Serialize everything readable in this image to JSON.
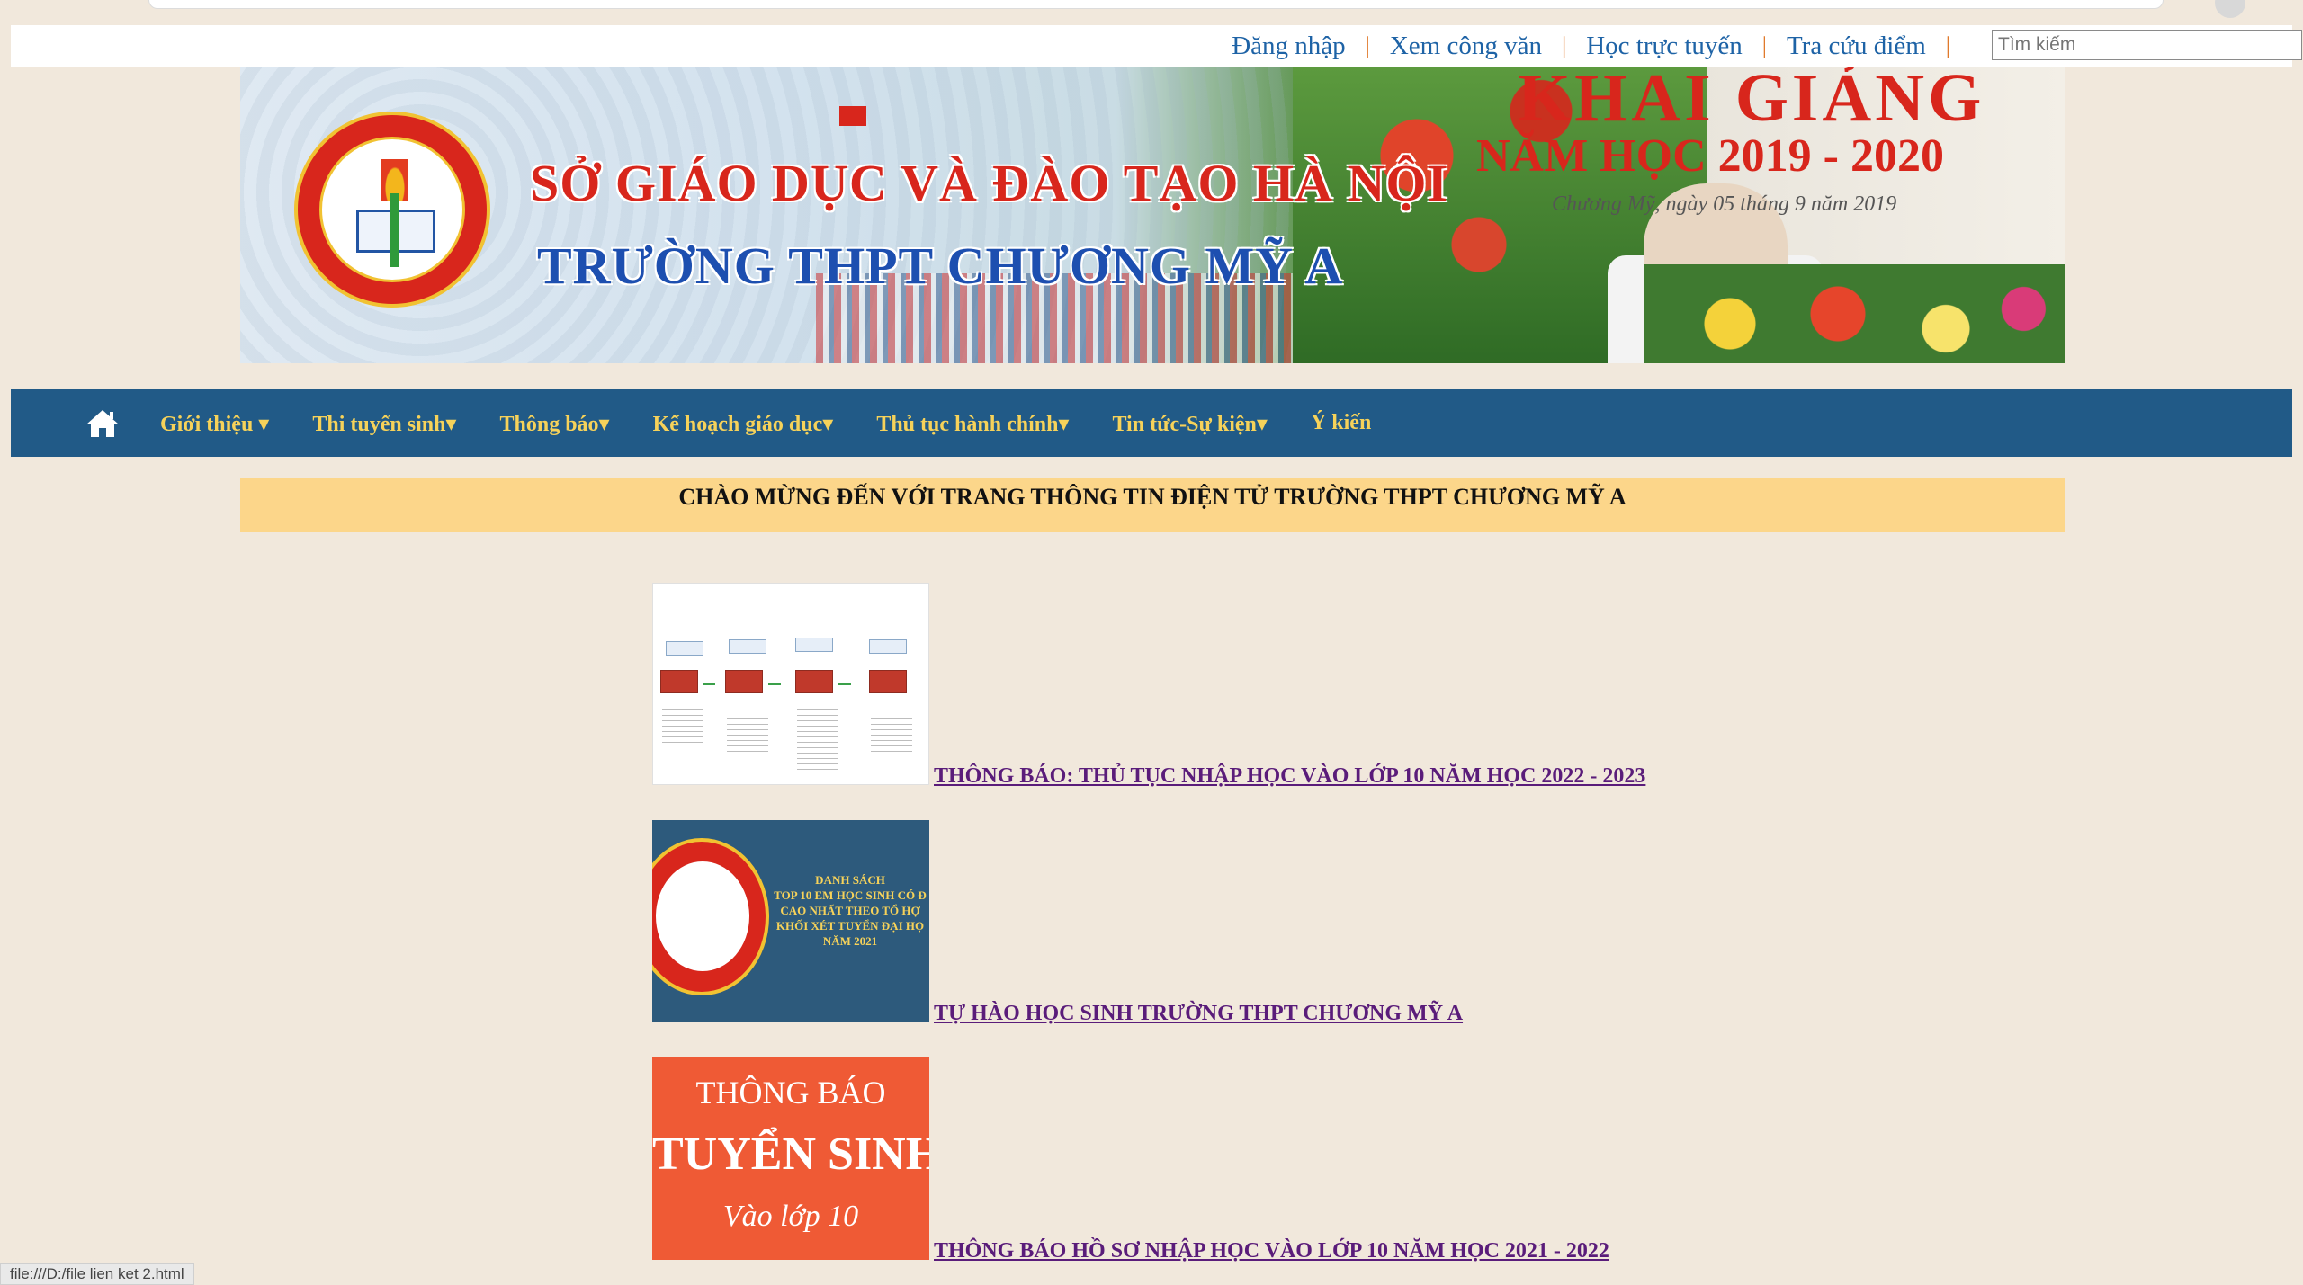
{
  "top_links": [
    "Đăng nhập",
    "Xem công văn",
    "Học trực tuyến",
    "Tra cứu điểm"
  ],
  "search": {
    "placeholder": "Tìm kiếm"
  },
  "banner": {
    "line1": "SỞ GIÁO DỤC VÀ ĐÀO TẠO HÀ NỘI",
    "line2": "TRƯỜNG THPT CHƯƠNG MỸ A",
    "event_title": "KHAI GIẢNG",
    "event_year": "NĂM HỌC 2019 - 2020",
    "event_date": "Chương Mỹ, ngày 05 tháng 9 năm 2019"
  },
  "nav": {
    "items": [
      "Giới thiệu ▾",
      "Thi tuyển sinh▾",
      "Thông báo▾",
      "Kế hoạch giáo dục▾",
      "Thủ tục hành chính▾",
      "Tin tức-Sự kiện▾",
      "Ý kiến"
    ]
  },
  "welcome": "CHÀO MỪNG ĐẾN VỚI TRANG THÔNG TIN ĐIỆN TỬ TRƯỜNG THPT CHƯƠNG MỸ A",
  "news": [
    {
      "title": "THÔNG BÁO: THỦ TỤC NHẬP HỌC VÀO LỚP 10 NĂM HỌC 2022 - 2023"
    },
    {
      "title": "TỰ HÀO HỌC SINH TRƯỜNG THPT CHƯƠNG MỸ A"
    },
    {
      "title": "THÔNG BÁO HỒ SƠ NHẬP HỌC VÀO LỚP 10 NĂM HỌC 2021 - 2022"
    }
  ],
  "thumb2_text": "DANH SÁCH\nTOP 10 EM HỌC SINH CÓ Đ\nCAO NHẤT THEO TỔ HỢ\nKHỐI XÉT TUYỂN ĐẠI HỌ\nNĂM 2021",
  "thumb3": {
    "line1": "THÔNG BÁO",
    "line2": "TUYỂN SINH",
    "line3": "Vào lớp 10"
  },
  "status_url": "file:///D:/file lien ket 2.html",
  "colors": {
    "nav_bg": "#215a87",
    "nav_text": "#f6d25a",
    "welcome_bg": "#fcd68a",
    "page_bg": "#f1e8dc",
    "link": "#5a1c7a",
    "top_link": "#1e63a6"
  }
}
